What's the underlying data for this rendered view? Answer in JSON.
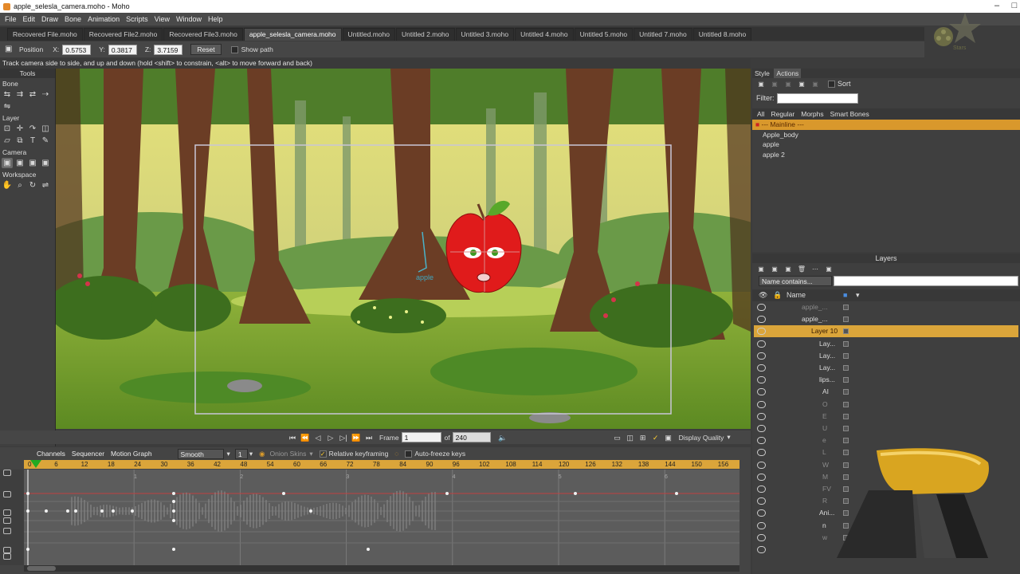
{
  "window": {
    "title": "apple_selesla_camera.moho - Moho"
  },
  "menu": [
    "File",
    "Edit",
    "Draw",
    "Bone",
    "Animation",
    "Scripts",
    "View",
    "Window",
    "Help"
  ],
  "tabs": [
    "Recovered File.moho",
    "Recovered File2.moho",
    "Recovered File3.moho",
    "apple_selesla_camera.moho",
    "Untitled.moho",
    "Untitled 2.moho",
    "Untitled 3.moho",
    "Untitled 4.moho",
    "Untitled 5.moho",
    "Untitled 7.moho",
    "Untitled 8.moho"
  ],
  "tool_options": {
    "position_label": "Position",
    "x_label": "X:",
    "x": "0.5753",
    "y_label": "Y:",
    "y": "0.3817",
    "z_label": "Z:",
    "z": "3.7159",
    "reset": "Reset",
    "show_path": "Show path"
  },
  "status": "Track camera side to side, and up and down (hold <shift> to constrain, <alt> to move forward and back)",
  "tools": {
    "title": "Tools",
    "sections": [
      "Bone",
      "Layer",
      "Camera",
      "Workspace"
    ]
  },
  "playback": {
    "frame_label": "Frame",
    "frame": "1",
    "of_label": "of",
    "total": "240",
    "display_quality": "Display Quality"
  },
  "timeline": {
    "tabs": [
      "Channels",
      "Sequencer",
      "Motion Graph"
    ],
    "interp": "Smooth",
    "interp_num": "1",
    "onion": "Onion Skins",
    "relative": "Relative keyframing",
    "autofreeze": "Auto-freeze keys",
    "ruler": [
      "0",
      "6",
      "12",
      "18",
      "24",
      "30",
      "36",
      "42",
      "48",
      "54",
      "60",
      "66",
      "72",
      "78",
      "84",
      "90",
      "96",
      "102",
      "108",
      "114",
      "120",
      "126",
      "132",
      "138",
      "144",
      "150",
      "156"
    ],
    "markers": [
      "1",
      "2",
      "3",
      "4",
      "5",
      "6"
    ]
  },
  "style_panel": {
    "tabs": [
      "Style",
      "Actions"
    ],
    "sort": "Sort",
    "filter_label": "Filter:",
    "filter_tabs": [
      "All",
      "Regular",
      "Morphs",
      "Smart Bones"
    ],
    "actions": [
      "--- Mainline ---",
      "Apple_body",
      "apple",
      "apple 2"
    ]
  },
  "layers_panel": {
    "title": "Layers",
    "name_filter": "Name contains...",
    "col_name": "Name",
    "rows": [
      "apple_...",
      "apple_...",
      "Layer 10",
      "Lay...",
      "Lay...",
      "Lay...",
      "lips...",
      "AI",
      "O",
      "E",
      "U",
      "e",
      "L",
      "W",
      "M",
      "FV",
      "R",
      "Ani...",
      "n",
      "w",
      ""
    ]
  },
  "canvas": {
    "apple_label": "apple"
  },
  "colors": {
    "accent": "#dba53a",
    "apple": "#e01b1b",
    "leaf": "#58a82a"
  }
}
